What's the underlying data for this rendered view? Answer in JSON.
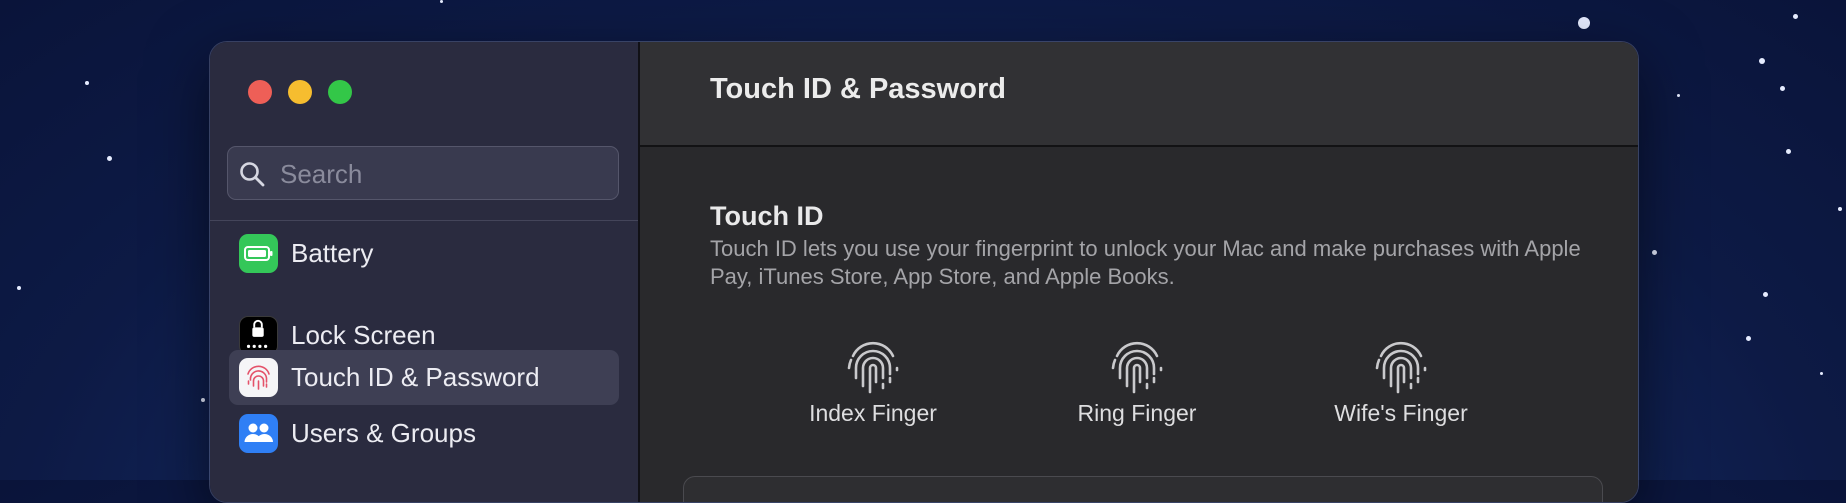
{
  "window": {
    "title": "Touch ID & Password",
    "traffic_lights": {
      "close_color": "#ee5f57",
      "minimize_color": "#f6bd2f",
      "zoom_color": "#33c748"
    }
  },
  "sidebar": {
    "search_placeholder": "Search",
    "items": [
      {
        "label": "Battery",
        "icon": "battery-icon",
        "color": "#34c759",
        "selected": false
      },
      {
        "label": "Lock Screen",
        "icon": "lock-screen-icon",
        "color": "#000000",
        "selected": false
      },
      {
        "label": "Touch ID & Password",
        "icon": "fingerprint-icon",
        "color": "#f5f5f7",
        "selected": true
      },
      {
        "label": "Users & Groups",
        "icon": "users-icon",
        "color": "#2f7ff5",
        "selected": false
      }
    ]
  },
  "main": {
    "section_title": "Touch ID",
    "section_description": "Touch ID lets you use your fingerprint to unlock your Mac and make purchases with Apple Pay, iTunes Store, App Store, and Apple Books.",
    "fingers": [
      {
        "label": "Index Finger",
        "icon": "fingerprint-icon"
      },
      {
        "label": "Ring Finger",
        "icon": "fingerprint-icon"
      },
      {
        "label": "Wife's Finger",
        "icon": "fingerprint-icon"
      }
    ]
  }
}
